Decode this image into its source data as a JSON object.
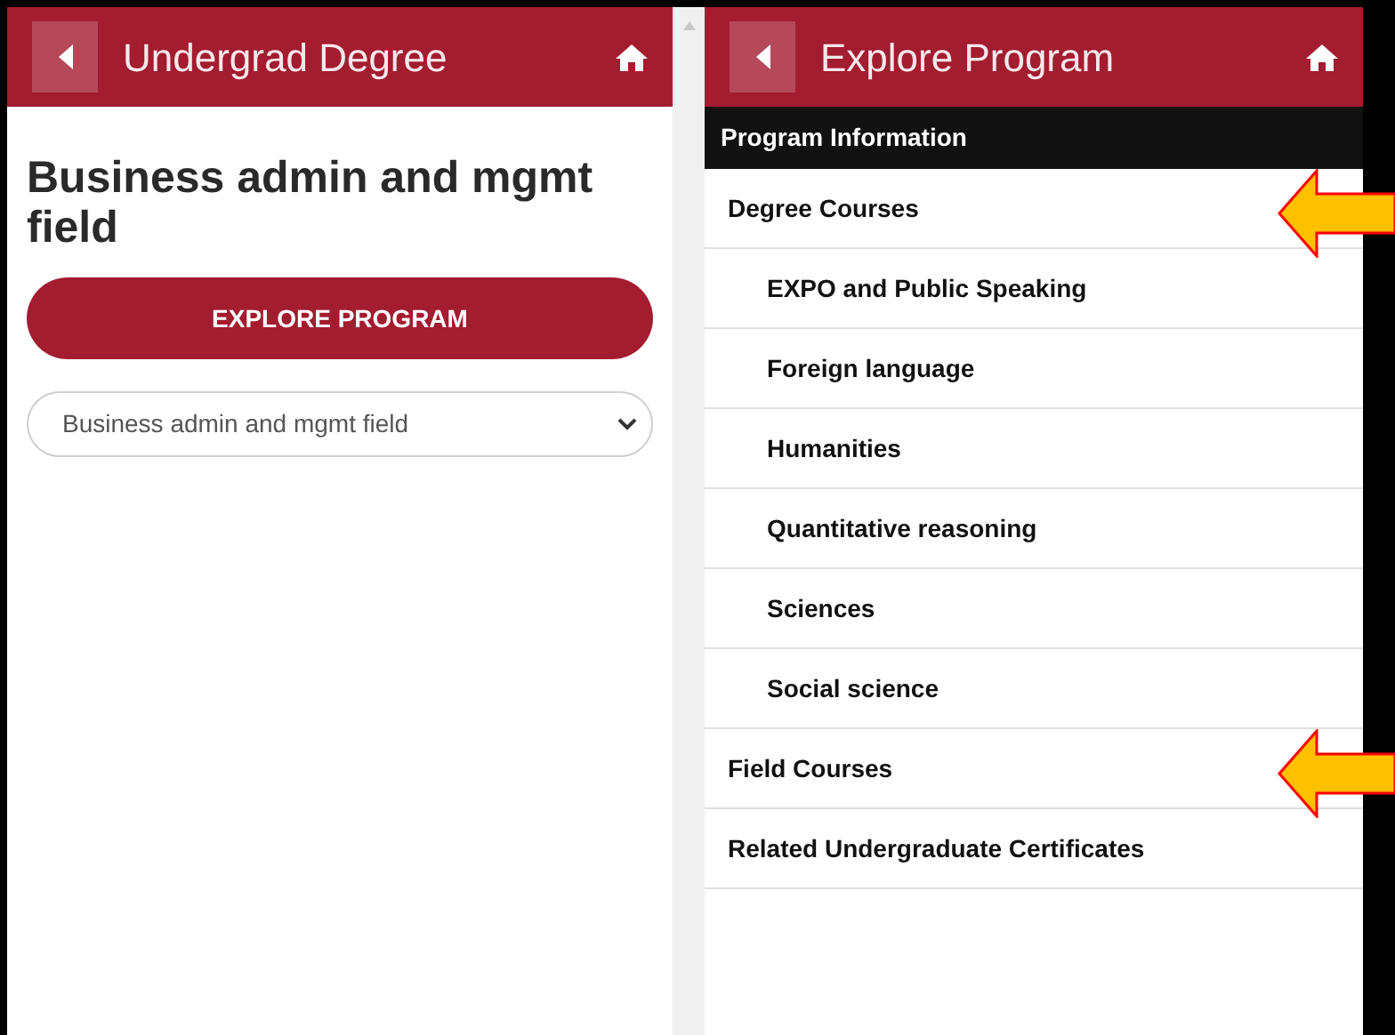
{
  "left_panel": {
    "header": {
      "title": "Undergrad Degree"
    },
    "heading": "Business admin and mgmt field",
    "explore_button": "EXPLORE PROGRAM",
    "program_select": {
      "value": "Business admin and mgmt field"
    }
  },
  "right_panel": {
    "header": {
      "title": "Explore Program"
    },
    "section_title": "Program Information",
    "items": [
      {
        "label": "Degree Courses",
        "highlighted": true,
        "children": [
          {
            "label": "EXPO and Public Speaking",
            "highlighted": false
          },
          {
            "label": "Foreign language",
            "highlighted": false
          },
          {
            "label": "Humanities",
            "highlighted": false
          },
          {
            "label": "Quantitative reasoning",
            "highlighted": false
          },
          {
            "label": "Sciences",
            "highlighted": false
          },
          {
            "label": "Social science",
            "highlighted": false
          }
        ]
      },
      {
        "label": "Field Courses",
        "highlighted": true
      },
      {
        "label": "Related Undergraduate Certificates",
        "highlighted": false
      }
    ]
  }
}
